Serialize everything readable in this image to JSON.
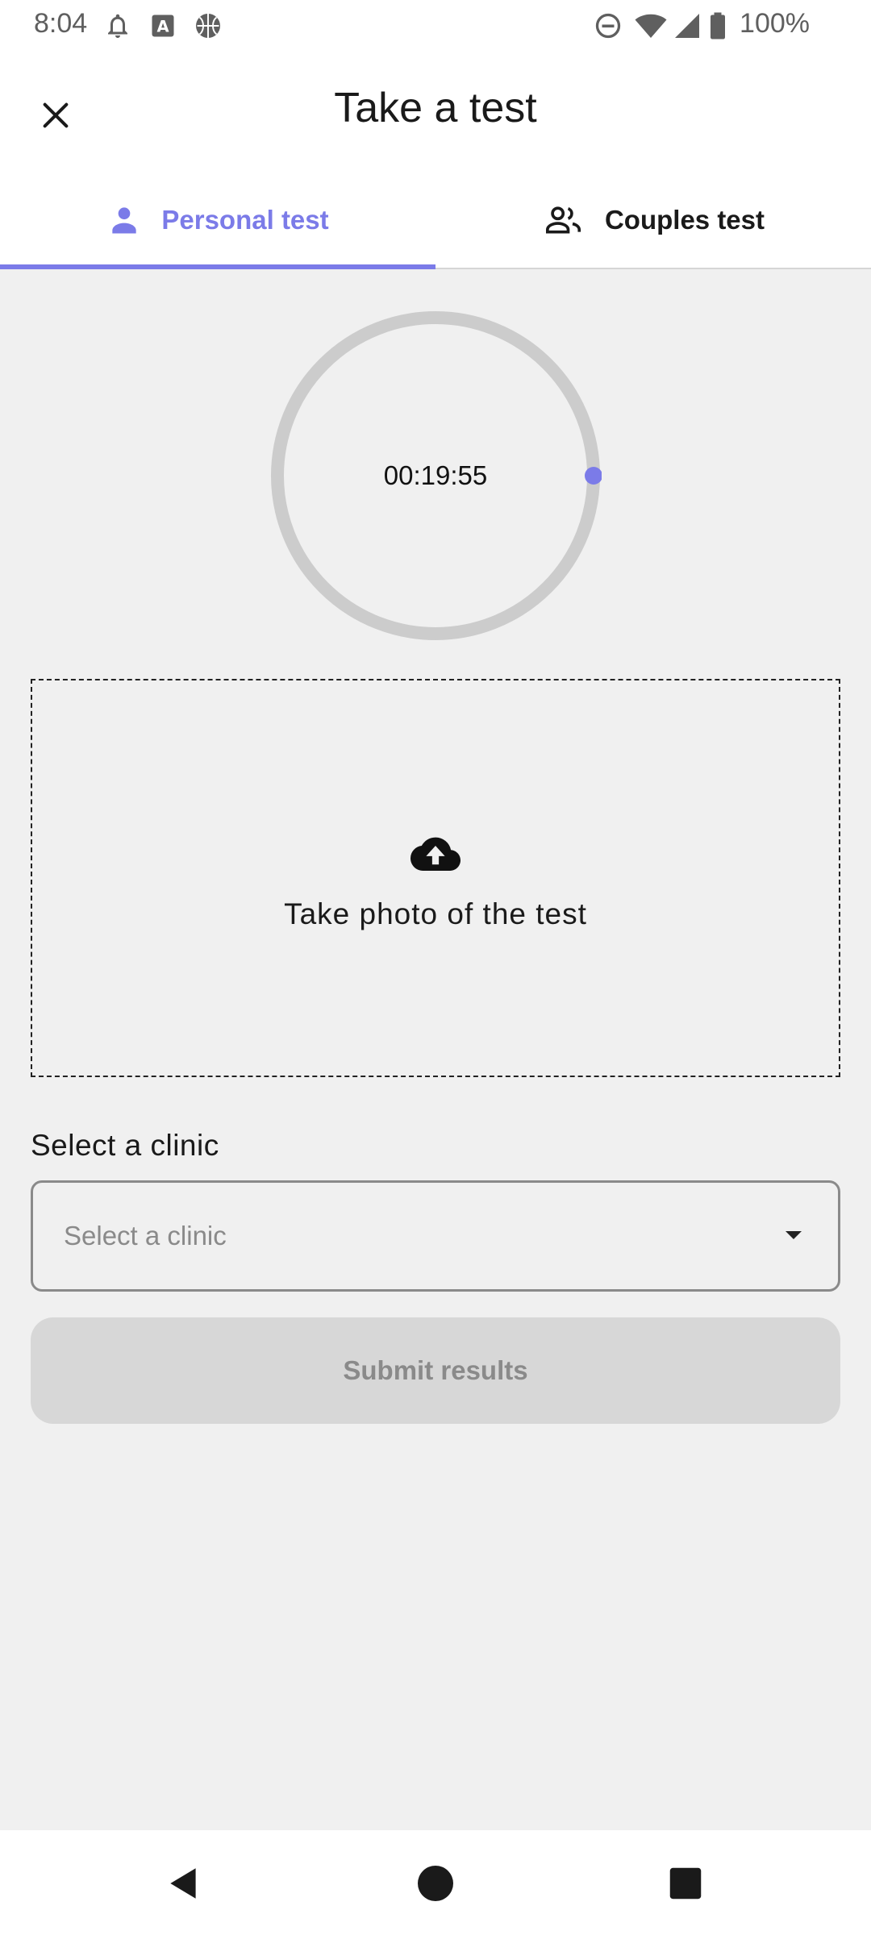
{
  "status_bar": {
    "time": "8:04",
    "battery": "100%",
    "icons": [
      "notification-bell-icon",
      "font-a-icon",
      "basketball-icon",
      "do-not-disturb-icon",
      "wifi-icon",
      "cell-signal-icon",
      "battery-icon"
    ]
  },
  "app_bar": {
    "title": "Take a test",
    "close_icon": "close-icon"
  },
  "tabs": [
    {
      "label": "Personal test",
      "icon": "person-icon",
      "selected": true
    },
    {
      "label": "Couples test",
      "icon": "people-icon",
      "selected": false
    }
  ],
  "timer": {
    "value": "00:19:55"
  },
  "upload": {
    "label": "Take photo of the test",
    "icon": "cloud-upload-icon"
  },
  "clinic": {
    "label": "Select a clinic",
    "placeholder": "Select a clinic",
    "icon": "dropdown-arrow-icon"
  },
  "submit": {
    "label": "Submit results",
    "enabled": false
  },
  "nav_bar": {
    "icons": [
      "back-icon",
      "home-icon",
      "recents-icon"
    ]
  },
  "colors": {
    "accent": "#7b7be8",
    "background": "#f0f0f0",
    "surface": "#ffffff",
    "disabled_button": "#d7d7d7",
    "disabled_text": "#8a8a8a",
    "ring": "#cccccc"
  }
}
